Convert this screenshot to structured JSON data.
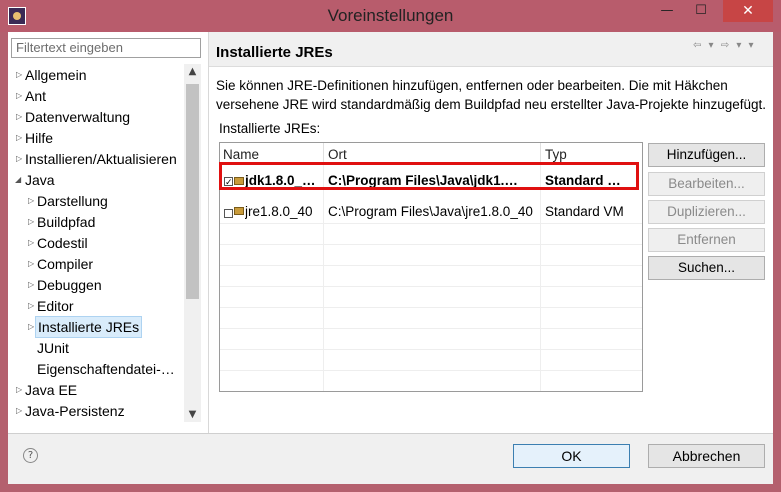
{
  "window": {
    "title": "Voreinstellungen",
    "minimize_glyph": "—",
    "maximize_glyph": "☐",
    "close_glyph": "✕"
  },
  "sidebar": {
    "filter_placeholder": "Filtertext eingeben",
    "items": [
      {
        "label": "Allgemein",
        "twisty": "▷"
      },
      {
        "label": "Ant",
        "twisty": "▷"
      },
      {
        "label": "Datenverwaltung",
        "twisty": "▷"
      },
      {
        "label": "Hilfe",
        "twisty": "▷"
      },
      {
        "label": "Installieren/Aktualisieren",
        "twisty": "▷"
      },
      {
        "label": "Java",
        "twisty": "◢"
      },
      {
        "label": "Darstellung",
        "twisty": "▷"
      },
      {
        "label": "Buildpfad",
        "twisty": "▷"
      },
      {
        "label": "Codestil",
        "twisty": "▷"
      },
      {
        "label": "Compiler",
        "twisty": "▷"
      },
      {
        "label": "Debuggen",
        "twisty": "▷"
      },
      {
        "label": "Editor",
        "twisty": "▷"
      },
      {
        "label": "Installierte JREs",
        "twisty": "▷"
      },
      {
        "label": "JUnit",
        "twisty": ""
      },
      {
        "label": "Eigenschaftendatei-…",
        "twisty": ""
      },
      {
        "label": "Java EE",
        "twisty": "▷"
      },
      {
        "label": "Java-Persistenz",
        "twisty": "▷"
      }
    ],
    "selected_item": "Installierte JREs"
  },
  "header": {
    "title": "Installierte JREs",
    "nav_arrows": "⇦ ▾ ⇨ ▾ ▾"
  },
  "main": {
    "description": "Sie können JRE-Definitionen hinzufügen, entfernen oder bearbeiten. Die mit Häkchen versehene JRE wird standardmäßig dem Buildpfad neu erstellter Java-Projekte hinzugefügt.",
    "list_label": "Installierte JREs:",
    "columns": [
      "Name",
      "Ort",
      "Typ"
    ],
    "rows": [
      {
        "name": "jdk1.8.0_…",
        "location": "C:\\Program Files\\Java\\jdk1.…",
        "type": "Standard …",
        "checked": true,
        "bold": true
      },
      {
        "name": "jre1.8.0_40",
        "location": "C:\\Program Files\\Java\\jre1.8.0_40",
        "type": "Standard VM",
        "checked": false,
        "bold": false
      }
    ],
    "buttons": {
      "add": "Hinzufügen...",
      "edit": "Bearbeiten...",
      "duplicate": "Duplizieren...",
      "remove": "Entfernen",
      "search": "Suchen..."
    },
    "highlight_color": "#e01010"
  },
  "footer": {
    "help_glyph": "?",
    "ok": "OK",
    "cancel": "Abbrechen"
  },
  "colors": {
    "title_bar": "#b85c6c",
    "close_button": "#c74545",
    "selection": "#d9ecfb"
  }
}
